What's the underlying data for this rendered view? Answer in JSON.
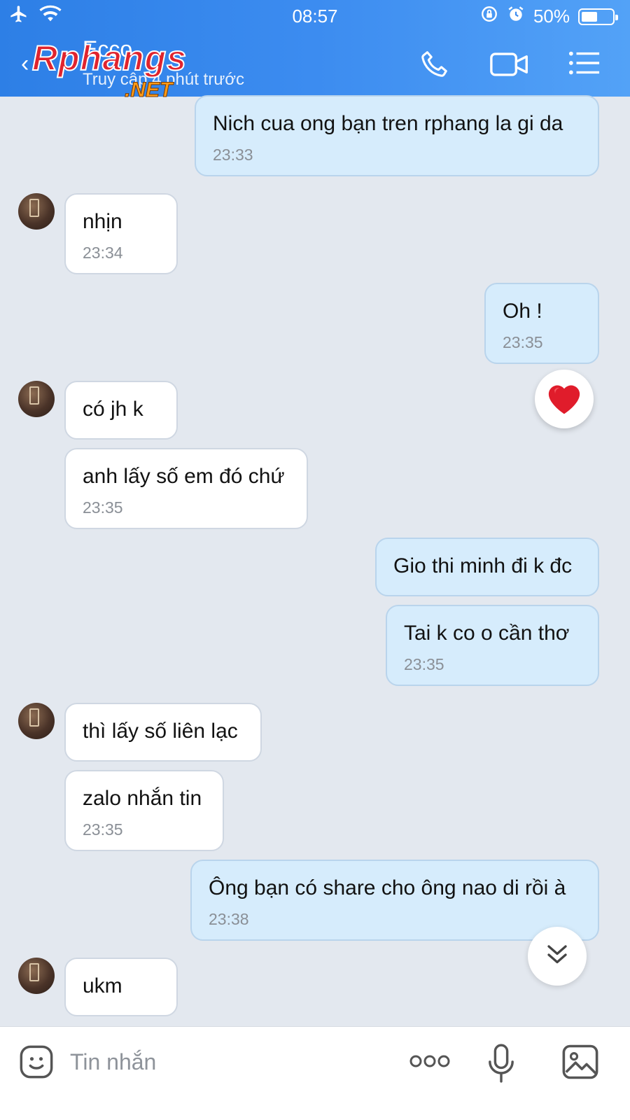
{
  "status_bar": {
    "time": "08:57",
    "battery": "50%"
  },
  "header": {
    "contact_name": "Ecco",
    "last_seen": "Truy cập 4 phút trước",
    "watermark": {
      "word1": "Rphangs",
      "word2": ".NET"
    }
  },
  "icons": {
    "airplane": "airplane-icon",
    "wifi": "wifi-icon",
    "lock": "rotation-lock-icon",
    "alarm": "alarm-icon",
    "back": "back-arrow-icon",
    "phone": "phone-icon",
    "video": "video-call-icon",
    "menu": "menu-icon",
    "sticker": "sticker-icon",
    "more": "more-options-icon",
    "mic": "microphone-icon",
    "image": "image-icon",
    "heart": "heart-icon",
    "scroll": "scroll-down-icon"
  },
  "messages": [
    {
      "dir": "out",
      "text": "Nich cua ong bạn tren rphang la gi da",
      "time": "23:33"
    },
    {
      "dir": "in",
      "text": "nhịn",
      "time": "23:34"
    },
    {
      "dir": "out",
      "text": "Oh !",
      "time": "23:35"
    },
    {
      "dir": "in",
      "text": "có jh k",
      "time": ""
    },
    {
      "dir": "in",
      "text": "anh lấy số em đó chứ",
      "time": "23:35"
    },
    {
      "dir": "out",
      "text": "Gio thi minh đi k đc",
      "time": ""
    },
    {
      "dir": "out",
      "text": "Tai k co o cần thơ",
      "time": "23:35"
    },
    {
      "dir": "in",
      "text": "thì lấy số liên lạc",
      "time": ""
    },
    {
      "dir": "in",
      "text": "zalo nhắn tin",
      "time": "23:35"
    },
    {
      "dir": "out",
      "text": "Ông bạn có share cho ông nao di rồi à",
      "time": "23:38"
    },
    {
      "dir": "in",
      "text": "ukm",
      "time": ""
    }
  ],
  "input": {
    "placeholder": "Tin nhắn",
    "value": ""
  },
  "colors": {
    "header_start": "#2d7fe6",
    "header_end": "#53a2f7",
    "outgoing_bubble": "#d6ecfc",
    "incoming_bubble": "#ffffff",
    "chat_bg": "#e3e8ef"
  }
}
